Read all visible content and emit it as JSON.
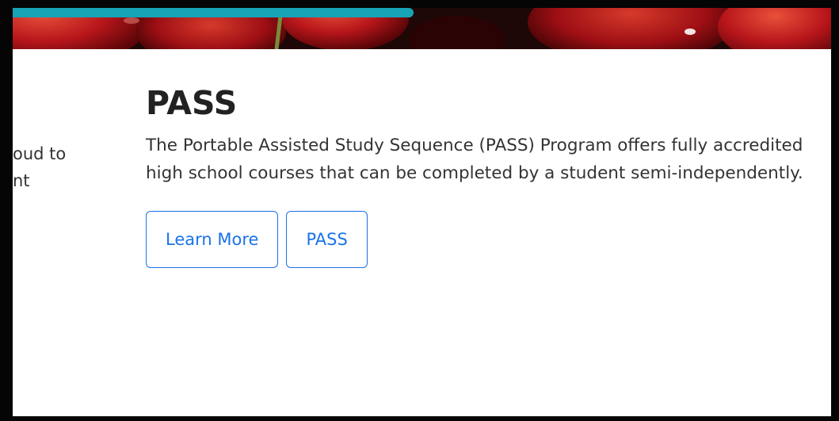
{
  "previous_card": {
    "lines": [
      "oud to",
      "nt"
    ]
  },
  "card": {
    "title": "PASS",
    "description": "The Portable Assisted Study Sequence (PASS) Program offers fully accredited high school courses that can be completed by a student semi-independently.",
    "buttons": {
      "learn_more": "Learn More",
      "pass": "PASS"
    }
  },
  "colors": {
    "accent": "#1a73e8",
    "progress": "#17a3b6",
    "frame": "#050505"
  }
}
